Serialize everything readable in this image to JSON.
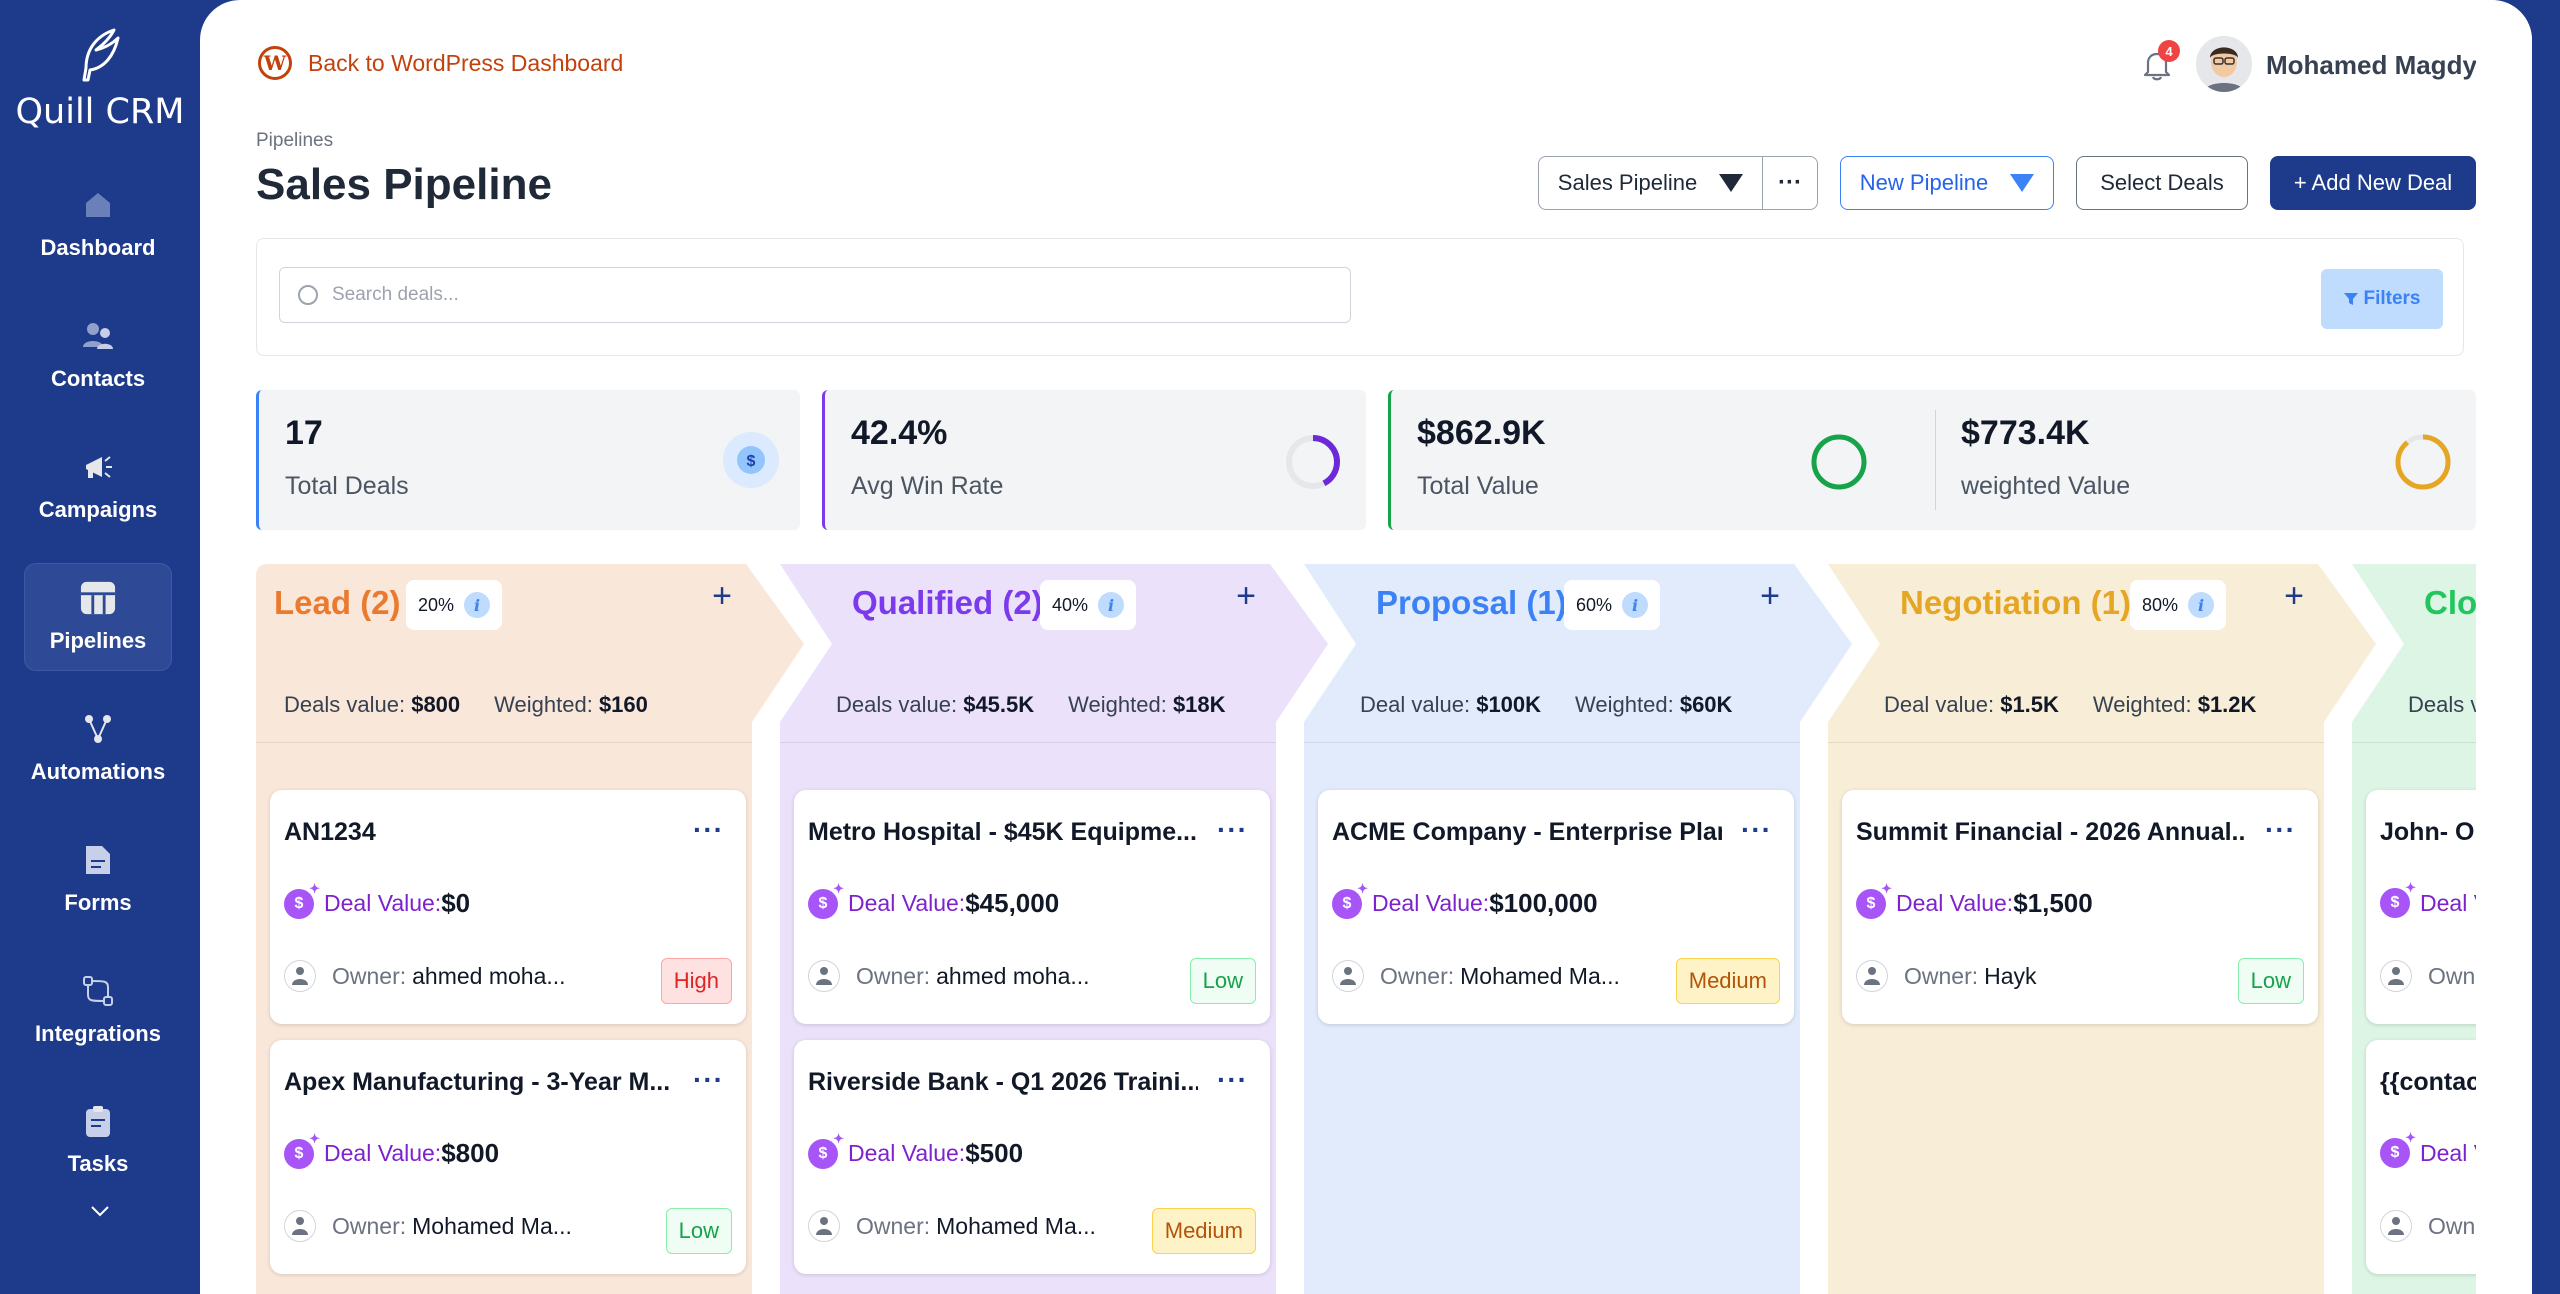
{
  "app": {
    "name": "Quill CRM"
  },
  "sidebar": {
    "items": [
      {
        "label": "Dashboard",
        "icon": "home-icon"
      },
      {
        "label": "Contacts",
        "icon": "users-icon"
      },
      {
        "label": "Campaigns",
        "icon": "megaphone-icon"
      },
      {
        "label": "Pipelines",
        "icon": "pipeline-icon",
        "active": true
      },
      {
        "label": "Automations",
        "icon": "automation-icon"
      },
      {
        "label": "Forms",
        "icon": "form-icon"
      },
      {
        "label": "Integrations",
        "icon": "integration-icon"
      },
      {
        "label": "Tasks",
        "icon": "clipboard-icon"
      }
    ]
  },
  "header": {
    "back_link": "Back to WordPress Dashboard",
    "notifications": "4",
    "user_name": "Mohamed Magdy",
    "breadcrumb": "Pipelines",
    "title": "Sales Pipeline"
  },
  "toolbar": {
    "pipeline_select": "Sales Pipeline",
    "more": "···",
    "new_pipeline": "New Pipeline",
    "select_deals": "Select Deals",
    "add_deal": "+ Add New Deal"
  },
  "search": {
    "placeholder": "Search deals...",
    "filters": "Filters"
  },
  "stats": [
    {
      "value": "17",
      "label": "Total Deals"
    },
    {
      "value": "42.4%",
      "label": "Avg Win Rate"
    },
    {
      "value": "$862.9K",
      "label": "Total Value"
    },
    {
      "value": "$773.4K",
      "label": "weighted Value"
    }
  ],
  "colors": {
    "sidebar": "#1e3a8a",
    "lead": "#ea7a2f",
    "qualified": "#7c3aed",
    "proposal": "#3b82f6",
    "negotiation": "#e5a623",
    "closed": "#22c55e"
  },
  "stages": [
    {
      "title": "Lead (2)",
      "pct": "20%",
      "value_label": "Deals value:",
      "value": "$800",
      "weighted_label": "Weighted:",
      "weighted": "$160",
      "deals": [
        {
          "title": "AN1234",
          "value_label": "Deal Value:",
          "value": "$0",
          "owner_label": "Owner:",
          "owner": "ahmed moha...",
          "priority": "High"
        },
        {
          "title": "Apex Manufacturing - 3-Year M...",
          "value_label": "Deal Value:",
          "value": "$800",
          "owner_label": "Owner:",
          "owner": "Mohamed Ma...",
          "priority": "Low"
        }
      ]
    },
    {
      "title": "Qualified (2)",
      "pct": "40%",
      "value_label": "Deals value:",
      "value": "$45.5K",
      "weighted_label": "Weighted:",
      "weighted": "$18K",
      "deals": [
        {
          "title": "Metro Hospital - $45K Equipme...",
          "value_label": "Deal Value:",
          "value": "$45,000",
          "owner_label": "Owner:",
          "owner": "ahmed moha...",
          "priority": "Low"
        },
        {
          "title": "Riverside Bank - Q1 2026 Traini...",
          "value_label": "Deal Value:",
          "value": "$500",
          "owner_label": "Owner:",
          "owner": "Mohamed Ma...",
          "priority": "Medium"
        }
      ]
    },
    {
      "title": "Proposal (1)",
      "pct": "60%",
      "value_label": "Deal value:",
      "value": "$100K",
      "weighted_label": "Weighted:",
      "weighted": "$60K",
      "deals": [
        {
          "title": "ACME Company - Enterprise Plan",
          "value_label": "Deal Value:",
          "value": "$100,000",
          "owner_label": "Owner:",
          "owner": "Mohamed Ma...",
          "priority": "Medium"
        }
      ]
    },
    {
      "title": "Negotiation (1)",
      "pct": "80%",
      "value_label": "Deal value:",
      "value": "$1.5K",
      "weighted_label": "Weighted:",
      "weighted": "$1.2K",
      "deals": [
        {
          "title": "Summit Financial - 2026 Annual...",
          "value_label": "Deal Value:",
          "value": "$1,500",
          "owner_label": "Owner:",
          "owner": "Hayk",
          "priority": "Low"
        }
      ]
    },
    {
      "title": "Clos",
      "value_label": "Deals v",
      "deals": [
        {
          "title": "John- On",
          "value_label": "Deal V",
          "owner_label": "Own"
        },
        {
          "title": "{{contac",
          "value_label": "Deal V",
          "owner_label": "Own"
        }
      ]
    }
  ]
}
